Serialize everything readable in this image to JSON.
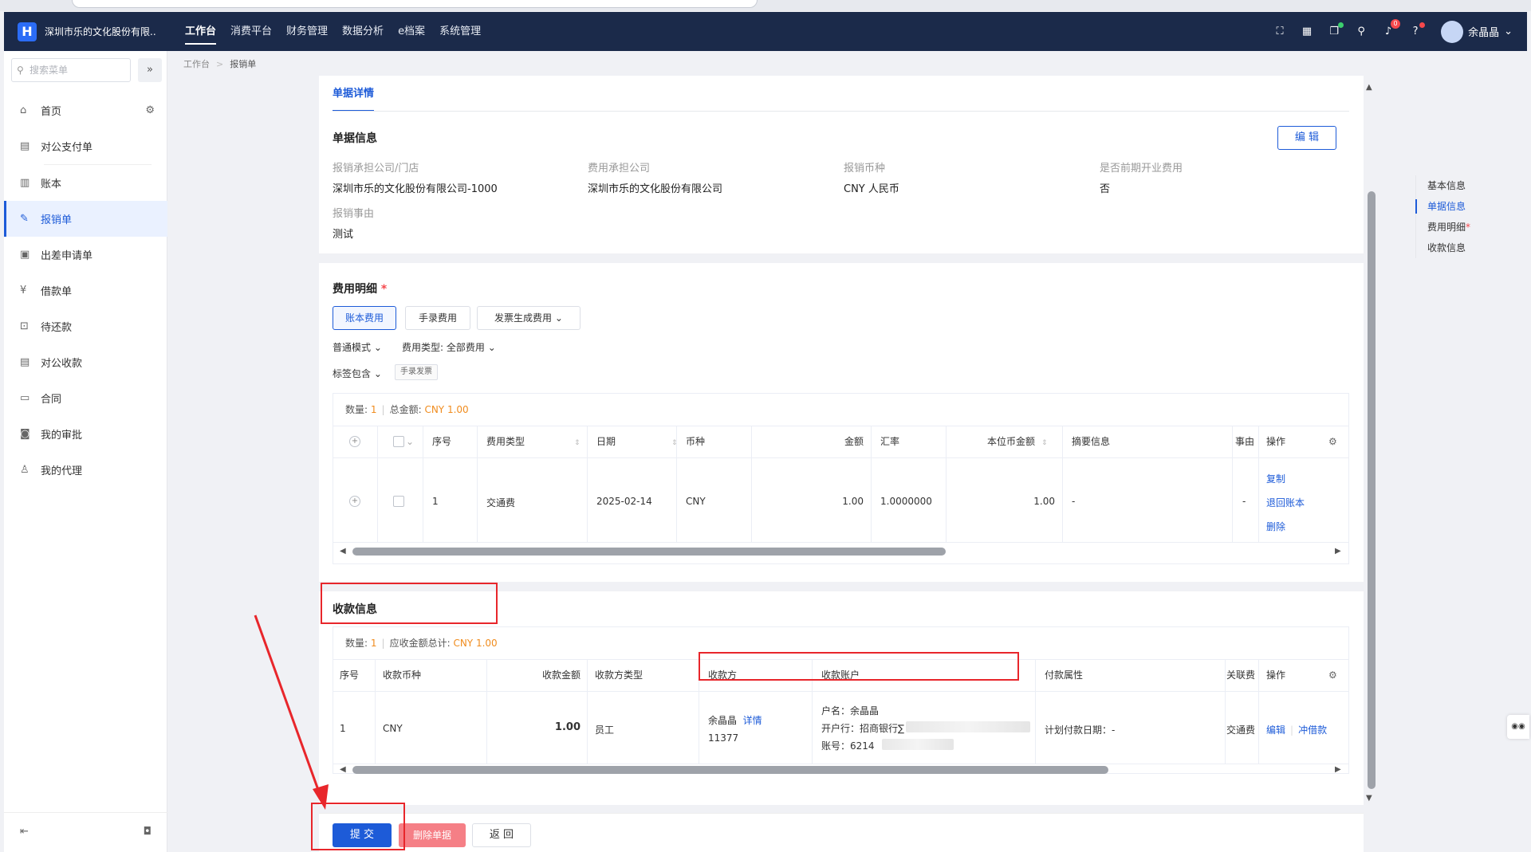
{
  "header": {
    "logo_glyph": "H",
    "company": "深圳市乐的文化股份有限...",
    "nav": [
      "工作台",
      "消费平台",
      "财务管理",
      "数据分析",
      "e档案",
      "系统管理"
    ],
    "notification_count": "0",
    "user_name": "余晶晶"
  },
  "sidebar": {
    "search_placeholder": "搜索菜单",
    "items": [
      "首页",
      "对公支付单",
      "账本",
      "报销单",
      "出差申请单",
      "借款单",
      "待还款",
      "对公收款",
      "合同",
      "我的审批",
      "我的代理"
    ]
  },
  "breadcrumb": [
    "工作台",
    "报销单"
  ],
  "tabs": [
    "单据详情"
  ],
  "doc_info": {
    "title": "单据信息",
    "edit_label": "编 辑",
    "fields": [
      {
        "label": "报销承担公司/门店",
        "value": "深圳市乐的文化股份有限公司-1000"
      },
      {
        "label": "费用承担公司",
        "value": "深圳市乐的文化股份有限公司"
      },
      {
        "label": "报销币种",
        "value": "CNY 人民币"
      },
      {
        "label": "是否前期开业费用",
        "value": "否"
      },
      {
        "label": "报销事由",
        "value": "测试"
      }
    ]
  },
  "expense": {
    "title": "费用明细",
    "required_mark": "*",
    "buttons": [
      "账本费用",
      "手录费用",
      "发票生成费用"
    ],
    "mode_filter": "普通模式",
    "type_filter_label": "费用类型:",
    "type_filter_value": "全部费用",
    "tag_filter": "标签包含",
    "tag_value": "手录发票",
    "summary_count_label": "数量:",
    "summary_count": "1",
    "summary_total_label": "总金额:",
    "summary_total": "CNY 1.00",
    "columns": [
      "序号",
      "费用类型",
      "日期",
      "币种",
      "金额",
      "汇率",
      "本位币金额",
      "摘要信息",
      "事由",
      "操作"
    ],
    "rows": [
      {
        "seq": "1",
        "type": "交通费",
        "date": "2025-02-14",
        "currency": "CNY",
        "amount": "1.00",
        "rate": "1.0000000",
        "base_amount": "1.00",
        "summary": "-",
        "reason": "-"
      }
    ],
    "actions": [
      "复制",
      "退回账本",
      "删除"
    ]
  },
  "payee": {
    "title": "收款信息",
    "summary_count_label": "数量:",
    "summary_count": "1",
    "summary_total_label": "应收金额总计:",
    "summary_total": "CNY 1.00",
    "columns": [
      "序号",
      "收款币种",
      "收款金额",
      "收款方类型",
      "收款方",
      "收款账户",
      "付款属性",
      "关联费",
      "操作"
    ],
    "row": {
      "seq": "1",
      "currency": "CNY",
      "amount": "1.00",
      "payee_type": "员工",
      "payee_name": "余晶晶",
      "payee_detail": "详情",
      "payee_id": "11377",
      "account_name": "户名：余晶晶",
      "bank": "开户行：招商银行∑",
      "account_no": "账号：6214",
      "payment_attr": "计划付款日期：-",
      "related": "交通费",
      "actions": [
        "编辑",
        "冲借款"
      ]
    }
  },
  "footer": {
    "submit": "提 交",
    "delete": "删除单据",
    "back": "返 回"
  },
  "anchors": [
    "基本信息",
    "单据信息",
    "费用明细",
    "收款信息"
  ],
  "anchor_required_mark": "*",
  "colors": {
    "primary": "#1d5bd8",
    "header_bg": "#1b2a4a",
    "danger": "#f57f86",
    "highlight": "#e8262b",
    "amount": "#f08c1e"
  }
}
